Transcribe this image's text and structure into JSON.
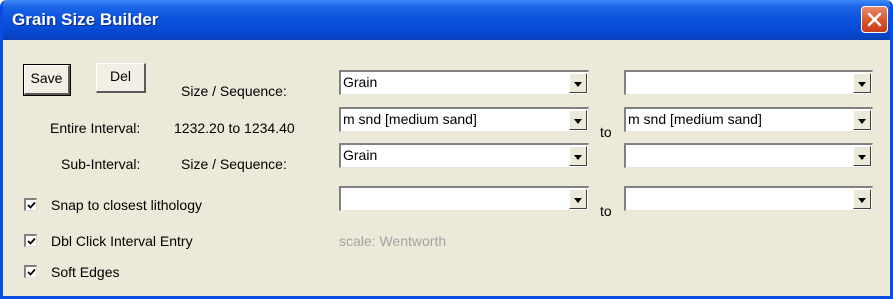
{
  "window": {
    "title": "Grain Size Builder"
  },
  "buttons": {
    "save": "Save",
    "del": "Del"
  },
  "labels": {
    "size_sequence": "Size / Sequence:",
    "entire_interval": "Entire Interval:",
    "interval_range": "1232.20 to 1234.40",
    "sub_interval": "Sub-Interval:",
    "sub_size_sequence": "Size / Sequence:",
    "to1": "to",
    "to2": "to",
    "scale": "scale: Wentworth"
  },
  "combos": {
    "row1_left": "Grain",
    "row1_right": "",
    "row2_left": "m snd  [medium sand]",
    "row2_right": "m snd  [medium sand]",
    "row3_left": "Grain",
    "row3_right": "",
    "row4_left": "",
    "row4_right": ""
  },
  "checkboxes": [
    {
      "label": "Snap to closest lithology",
      "checked": true
    },
    {
      "label": "Dbl Click Interval Entry",
      "checked": true
    },
    {
      "label": "Soft Edges",
      "checked": true
    }
  ]
}
